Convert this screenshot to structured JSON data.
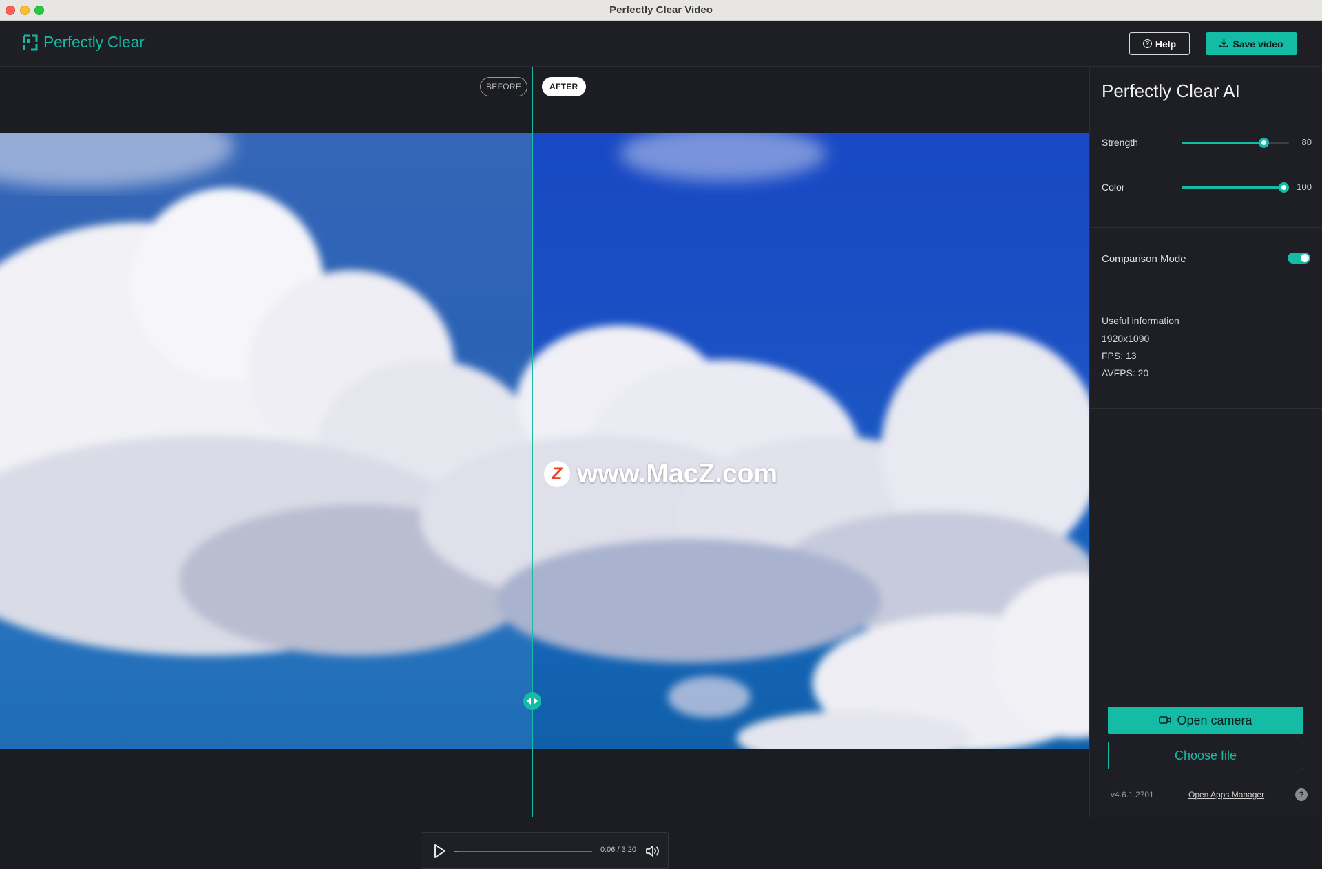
{
  "window": {
    "title": "Perfectly Clear Video"
  },
  "header": {
    "logo_text": "Perfectly Clear",
    "help_label": "Help",
    "save_label": "Save video"
  },
  "viewer": {
    "before_label": "BEFORE",
    "after_label": "AFTER",
    "watermark": "www.MacZ.com",
    "watermark_badge": "Z"
  },
  "player": {
    "time": "0:06 / 3:20",
    "progress": 0.03
  },
  "panel": {
    "title": "Perfectly Clear AI",
    "sliders": [
      {
        "label": "Strength",
        "value": 80
      },
      {
        "label": "Color",
        "value": 100
      }
    ],
    "comparison_label": "Comparison Mode",
    "comparison_on": true,
    "info": {
      "heading": "Useful information",
      "resolution": "1920x1090",
      "fps": "FPS: 13",
      "avfps": "AVFPS: 20"
    },
    "open_camera_label": "Open camera",
    "choose_file_label": "Choose file",
    "version": "v4.6.1.2701",
    "apps_manager_label": "Open Apps Manager",
    "help_glyph": "?"
  },
  "colors": {
    "accent": "#14bca6",
    "background": "#1c1d22",
    "panel": "#1e1f24"
  }
}
